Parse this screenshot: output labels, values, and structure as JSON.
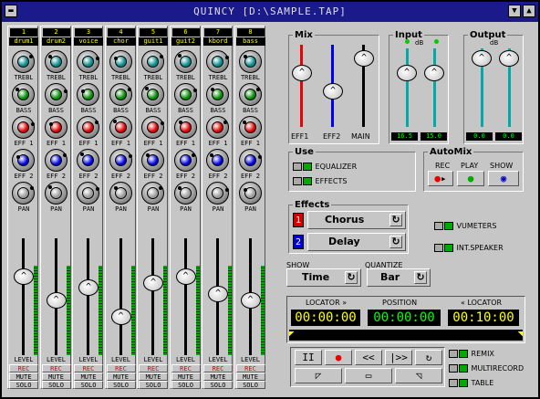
{
  "window": {
    "title": "QUINCY [D:\\SAMPLE.TAP]"
  },
  "channels": [
    {
      "num": "1",
      "name": "drum1"
    },
    {
      "num": "2",
      "name": "drum2"
    },
    {
      "num": "3",
      "name": "voice"
    },
    {
      "num": "4",
      "name": "chor"
    },
    {
      "num": "5",
      "name": "guit1"
    },
    {
      "num": "6",
      "name": "guit2"
    },
    {
      "num": "7",
      "name": "kbord"
    },
    {
      "num": "8",
      "name": "bass"
    }
  ],
  "strip_labels": {
    "treble": "TREBL",
    "bass": "BASS",
    "eff1": "EFF 1",
    "eff2": "EFF 2",
    "pan": "PAN",
    "level": "LEVEL",
    "rec": "REC",
    "mute": "MUTE",
    "solo": "SOLO"
  },
  "colors": {
    "treble": "#008a8a",
    "bass": "#008a00",
    "eff1": "#e00000",
    "eff2": "#0000e0",
    "pan": "#9a9a9a"
  },
  "fader_levels": [
    0.72,
    0.5,
    0.62,
    0.35,
    0.66,
    0.72,
    0.56,
    0.5
  ],
  "mix": {
    "title": "Mix",
    "labels": [
      "EFF1",
      "EFF2",
      "MAIN"
    ]
  },
  "input": {
    "title": "Input",
    "unit": "dB",
    "values": [
      "16.5",
      "15.0"
    ]
  },
  "output": {
    "title": "Output",
    "unit": "dB",
    "values": [
      "0.0",
      "0.0"
    ]
  },
  "use": {
    "title": "Use",
    "equalizer": "EQUALIZER",
    "effects": "EFFECTS"
  },
  "automix": {
    "title": "AutoMix",
    "rec": "REC",
    "play": "PLAY",
    "show": "SHOW"
  },
  "effects": {
    "title": "Effects",
    "slot1_num": "1",
    "slot1": "Chorus",
    "slot2_num": "2",
    "slot2": "Delay"
  },
  "toggles": {
    "vumeters": "VUMETERS",
    "speaker": "INT.SPEAKER"
  },
  "show": {
    "label": "SHOW",
    "value": "Time"
  },
  "quantize": {
    "label": "QUANTIZE",
    "value": "Bar"
  },
  "locators": {
    "locator_left": "LOCATOR »",
    "position": "POSITION",
    "locator_right": "« LOCATOR",
    "left_time": "00:00:00",
    "position_time": "00:00:00",
    "right_time": "00:10:00"
  },
  "transport": {
    "pause": "II",
    "record": "●",
    "rewind": "<<",
    "play": "|>>",
    "loop": "↻"
  },
  "options": {
    "remix": "REMIX",
    "multirecord": "MULTIRECORD",
    "table": "TABLE"
  }
}
